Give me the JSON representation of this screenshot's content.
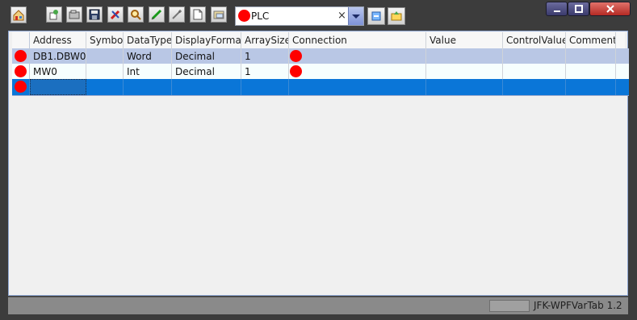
{
  "toolbar": {
    "icons": [
      "home-icon",
      "add-row-icon",
      "open-folder-icon",
      "save-icon",
      "settings-tools-icon",
      "search-icon",
      "edit-pencil-icon",
      "wand-icon",
      "document-icon",
      "open-file-icon",
      "plc-config-icon",
      "plc-folder-icon"
    ],
    "plc_selector": {
      "status_color": "#ff0000",
      "value": "PLC",
      "clear_glyph": "×"
    }
  },
  "window_controls": {
    "minimize": "minimize-icon",
    "maximize": "maximize-icon",
    "close": "close-icon"
  },
  "grid": {
    "columns": [
      "Address",
      "Symbol",
      "DataType",
      "DisplayFormat",
      "ArraySize",
      "Connection",
      "Value",
      "ControlValue",
      "Comment"
    ],
    "rows": [
      {
        "address": "DB1.DBW0",
        "symbol": "",
        "datatype": "Word",
        "displayformat": "Decimal",
        "arraysize": "1",
        "connection_status": "red",
        "value": "",
        "controlvalue": "",
        "comment": ""
      },
      {
        "address": "MW0",
        "symbol": "",
        "datatype": "Int",
        "displayformat": "Decimal",
        "arraysize": "1",
        "connection_status": "red",
        "value": "",
        "controlvalue": "",
        "comment": ""
      },
      {
        "address": "",
        "symbol": "",
        "datatype": "",
        "displayformat": "",
        "arraysize": "",
        "connection_status": "",
        "value": "",
        "controlvalue": "",
        "comment": ""
      }
    ],
    "colors": {
      "status_red": "#ff0000",
      "selected_row": "#0a76d8",
      "alt_row": "#b9c7e5"
    }
  },
  "statusbar": {
    "version": "JFK-WPFVarTab 1.2"
  }
}
